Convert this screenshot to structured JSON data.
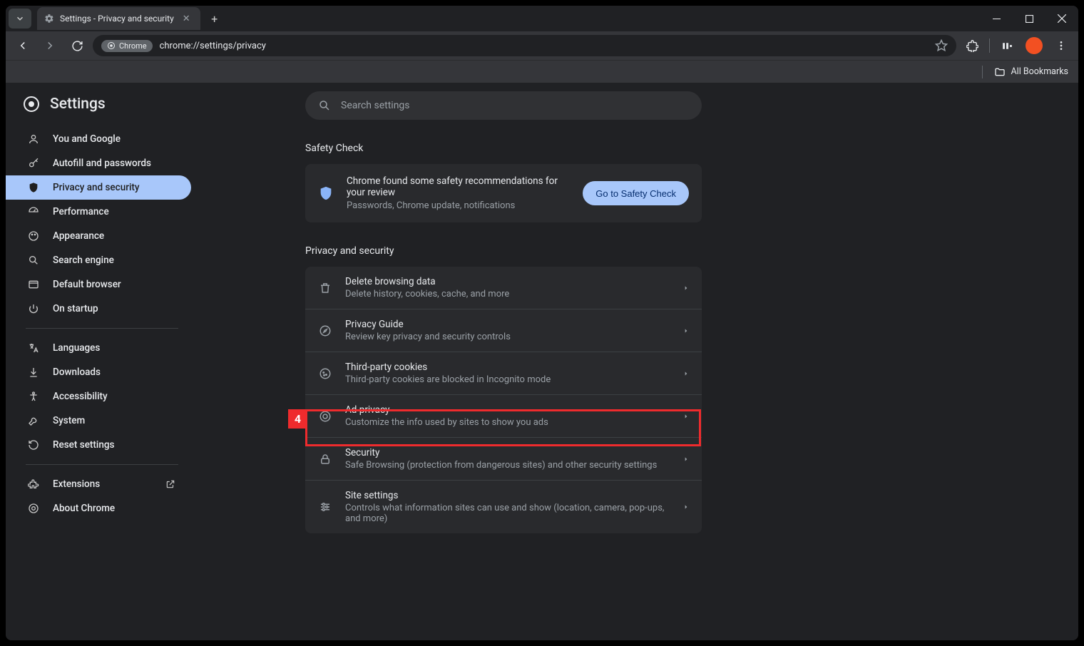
{
  "tab": {
    "title": "Settings - Privacy and security"
  },
  "omnibox": {
    "chip": "Chrome",
    "url": "chrome://settings/privacy"
  },
  "bookmarks": {
    "all": "All Bookmarks"
  },
  "sidebar": {
    "title": "Settings",
    "items": [
      {
        "label": "You and Google"
      },
      {
        "label": "Autofill and passwords"
      },
      {
        "label": "Privacy and security"
      },
      {
        "label": "Performance"
      },
      {
        "label": "Appearance"
      },
      {
        "label": "Search engine"
      },
      {
        "label": "Default browser"
      },
      {
        "label": "On startup"
      }
    ],
    "items2": [
      {
        "label": "Languages"
      },
      {
        "label": "Downloads"
      },
      {
        "label": "Accessibility"
      },
      {
        "label": "System"
      },
      {
        "label": "Reset settings"
      }
    ],
    "items3": [
      {
        "label": "Extensions"
      },
      {
        "label": "About Chrome"
      }
    ]
  },
  "search": {
    "placeholder": "Search settings"
  },
  "safety": {
    "heading": "Safety Check",
    "line1": "Chrome found some safety recommendations for your review",
    "line2": "Passwords, Chrome update, notifications",
    "button": "Go to Safety Check"
  },
  "privacy": {
    "heading": "Privacy and security",
    "rows": [
      {
        "title": "Delete browsing data",
        "sub": "Delete history, cookies, cache, and more"
      },
      {
        "title": "Privacy Guide",
        "sub": "Review key privacy and security controls"
      },
      {
        "title": "Third-party cookies",
        "sub": "Third-party cookies are blocked in Incognito mode"
      },
      {
        "title": "Ad privacy",
        "sub": "Customize the info used by sites to show you ads"
      },
      {
        "title": "Security",
        "sub": "Safe Browsing (protection from dangerous sites) and other security settings"
      },
      {
        "title": "Site settings",
        "sub": "Controls what information sites can use and show (location, camera, pop-ups, and more)"
      }
    ]
  },
  "annotation": {
    "number": "4"
  }
}
